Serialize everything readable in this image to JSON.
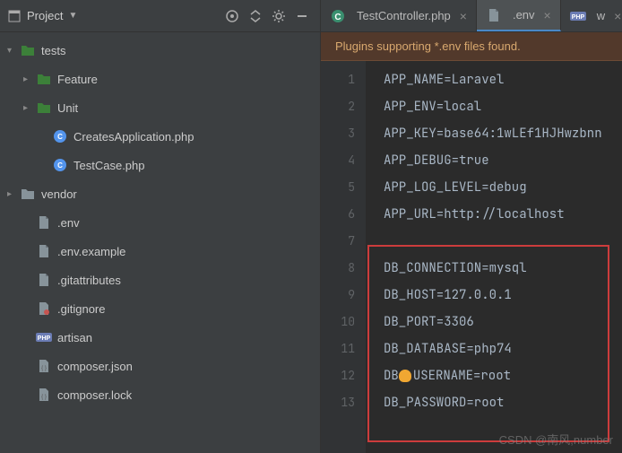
{
  "sidebar": {
    "title": "Project",
    "items": [
      {
        "label": "tests",
        "arrow": "down",
        "icon": "folder-green",
        "indent": 0
      },
      {
        "label": "Feature",
        "arrow": "right",
        "icon": "folder-green",
        "indent": 1
      },
      {
        "label": "Unit",
        "arrow": "right",
        "icon": "folder-green",
        "indent": 1
      },
      {
        "label": "CreatesApplication.php",
        "arrow": "none",
        "icon": "php",
        "indent": 2
      },
      {
        "label": "TestCase.php",
        "arrow": "none",
        "icon": "php",
        "indent": 2
      },
      {
        "label": "vendor",
        "arrow": "right",
        "icon": "folder",
        "indent": 0
      },
      {
        "label": ".env",
        "arrow": "none",
        "icon": "file",
        "indent": 1
      },
      {
        "label": ".env.example",
        "arrow": "none",
        "icon": "file",
        "indent": 1
      },
      {
        "label": ".gitattributes",
        "arrow": "none",
        "icon": "file",
        "indent": 1
      },
      {
        "label": ".gitignore",
        "arrow": "none",
        "icon": "gitignore",
        "indent": 1
      },
      {
        "label": "artisan",
        "arrow": "none",
        "icon": "php-badge",
        "indent": 1
      },
      {
        "label": "composer.json",
        "arrow": "none",
        "icon": "json",
        "indent": 1
      },
      {
        "label": "composer.lock",
        "arrow": "none",
        "icon": "json",
        "indent": 1
      }
    ]
  },
  "tabs": [
    {
      "label": "TestController.php",
      "icon": "c-icon",
      "active": false
    },
    {
      "label": ".env",
      "icon": "file",
      "active": true
    },
    {
      "label": "w",
      "icon": "php-badge",
      "active": false
    }
  ],
  "notification": "Plugins supporting *.env files found.",
  "code_lines": [
    "APP_NAME=Laravel",
    "APP_ENV=local",
    "APP_KEY=base64:1wLEf1HJHwzbnn",
    "APP_DEBUG=true",
    "APP_LOG_LEVEL=debug",
    "APP_URL=http://localhost",
    "",
    "DB_CONNECTION=mysql",
    "DB_HOST=127.0.0.1",
    "DB_PORT=3306",
    "DB_DATABASE=php74",
    "DB_USERNAME=root",
    "DB_PASSWORD=root"
  ],
  "watermark": "CSDN @南风,number"
}
